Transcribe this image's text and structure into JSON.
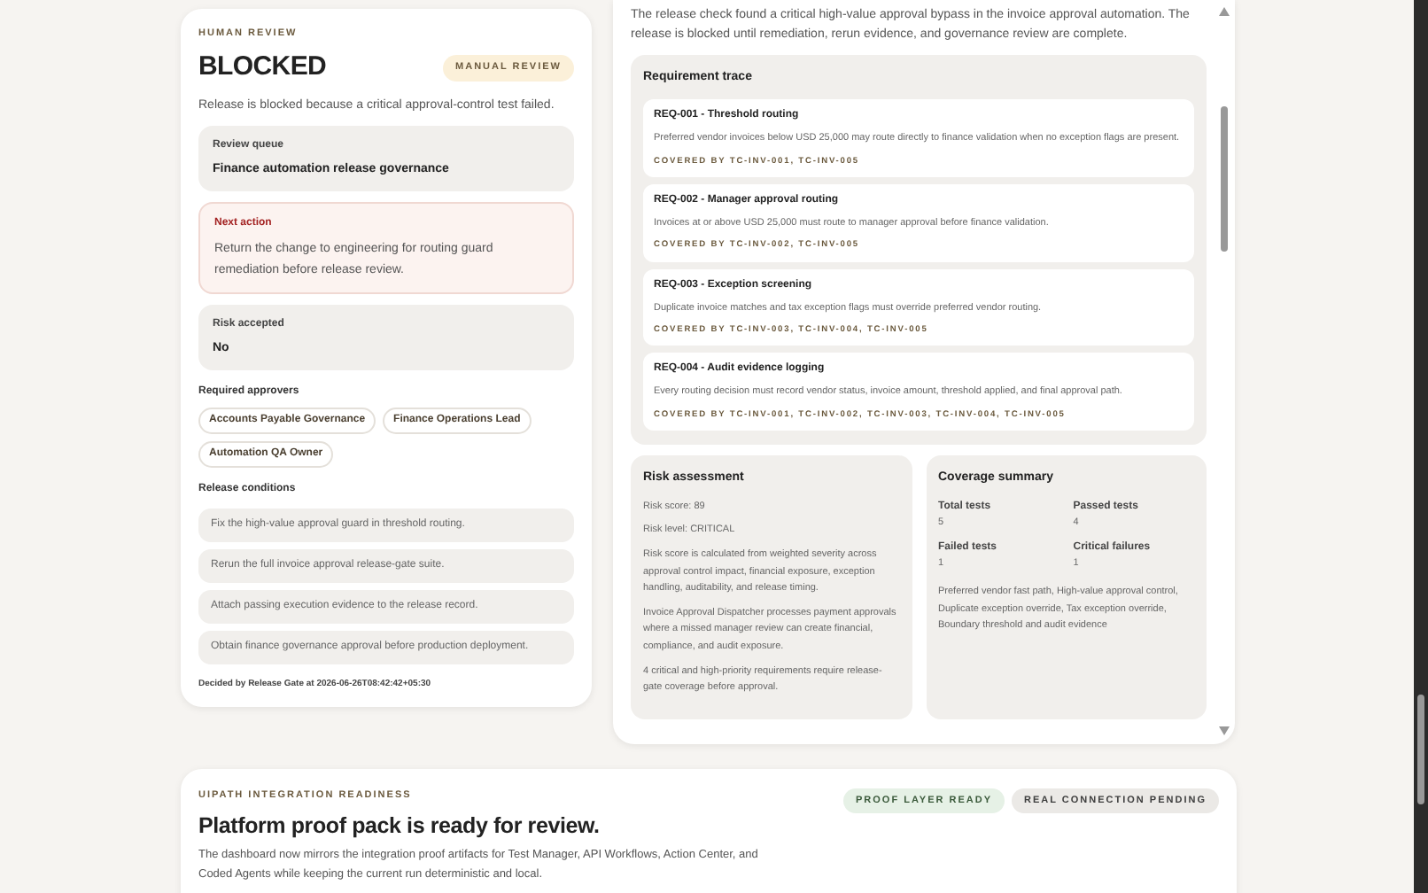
{
  "review": {
    "eyebrow": "HUMAN REVIEW",
    "status": "BLOCKED",
    "badge": "MANUAL REVIEW",
    "summary": "Release is blocked because a critical approval-control test failed.",
    "facts": [
      {
        "kind": "neutral",
        "label": "Review queue",
        "value": "Finance automation release governance"
      },
      {
        "kind": "alert",
        "label": "Next action",
        "value": "Return the change to engineering for routing guard remediation before release review."
      },
      {
        "kind": "neutral",
        "label": "Risk accepted",
        "value": "No"
      }
    ],
    "approvers_label": "Required approvers",
    "approvers": [
      "Accounts Payable Governance",
      "Finance Operations Lead",
      "Automation QA Owner"
    ],
    "conditions_label": "Release conditions",
    "conditions": [
      "Fix the high-value approval guard in threshold routing.",
      "Rerun the full invoice approval release-gate suite.",
      "Attach passing execution evidence to the release record.",
      "Obtain finance governance approval before production deployment."
    ],
    "decided": "Decided by Release Gate at 2026-06-26T08:42:42+05:30"
  },
  "detail": {
    "summary": "The release check found a critical high-value approval bypass in the invoice approval automation. The release is blocked until remediation, rerun evidence, and governance review are complete.",
    "trace": {
      "title": "Requirement trace",
      "requirements": [
        {
          "title": "REQ-001 - Threshold routing",
          "description": "Preferred vendor invoices below USD 25,000 may route directly to finance validation when no exception flags are present.",
          "coverage": "COVERED BY TC-INV-001, TC-INV-005"
        },
        {
          "title": "REQ-002 - Manager approval routing",
          "description": "Invoices at or above USD 25,000 must route to manager approval before finance validation.",
          "coverage": "COVERED BY TC-INV-002, TC-INV-005"
        },
        {
          "title": "REQ-003 - Exception screening",
          "description": "Duplicate invoice matches and tax exception flags must override preferred vendor routing.",
          "coverage": "COVERED BY TC-INV-003, TC-INV-004, TC-INV-005"
        },
        {
          "title": "REQ-004 - Audit evidence logging",
          "description": "Every routing decision must record vendor status, invoice amount, threshold applied, and final approval path.",
          "coverage": "COVERED BY TC-INV-001, TC-INV-002, TC-INV-003, TC-INV-004, TC-INV-005"
        }
      ]
    },
    "risk": {
      "title": "Risk assessment",
      "lines": [
        "Risk score: 89",
        "Risk level: CRITICAL",
        "Risk score is calculated from weighted severity across approval control impact, financial exposure, exception handling, auditability, and release timing.",
        "Invoice Approval Dispatcher processes payment approvals where a missed manager review can create financial, compliance, and audit exposure.",
        "4 critical and high-priority requirements require release-gate coverage before approval."
      ]
    },
    "coverage": {
      "title": "Coverage summary",
      "stats": [
        {
          "label": "Total tests",
          "value": "5"
        },
        {
          "label": "Passed tests",
          "value": "4"
        },
        {
          "label": "Failed tests",
          "value": "1"
        },
        {
          "label": "Critical failures",
          "value": "1"
        }
      ],
      "note": "Preferred vendor fast path, High-value approval control, Duplicate exception override, Tax exception override, Boundary threshold and audit evidence"
    }
  },
  "integration": {
    "eyebrow": "UIPATH INTEGRATION READINESS",
    "title": "Platform proof pack is ready for review.",
    "badges": [
      {
        "label": "PROOF LAYER READY",
        "kind": "ready"
      },
      {
        "label": "REAL CONNECTION PENDING",
        "kind": "pending"
      }
    ],
    "text": "The dashboard now mirrors the integration proof artifacts for Test Manager, API Workflows, Action Center, and Coded Agents while keeping the current run deterministic and local."
  }
}
